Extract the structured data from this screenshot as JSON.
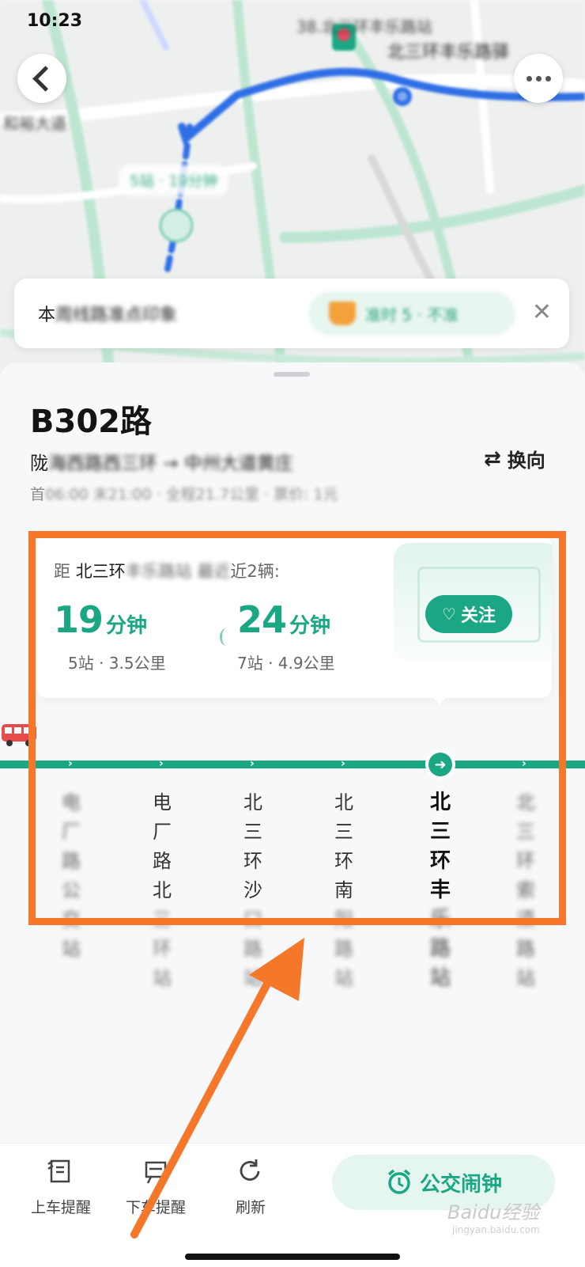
{
  "status_bar": {
    "time": "10:23"
  },
  "notice": {
    "text_visible": "本",
    "text_blurred": "周线路准点印象",
    "badge": "准时 5 · 不准",
    "close": "✕"
  },
  "route": {
    "title": "B302路",
    "direction_visible": "陇",
    "direction_blurred": "海西路西三环 → 中州大道黄庄",
    "info_visible": "首",
    "info_blurred": "06:00 末21:00 · 全程21.7公里 · 票价: 1元",
    "reverse_label": "换向"
  },
  "arrival": {
    "prefix": "距",
    "stop": "北三环",
    "blurred_mid": "丰乐路站 最近",
    "suffix": "近2辆:",
    "buses": [
      {
        "minutes": "19",
        "unit": "分钟",
        "detail": "5站 · 3.5公里"
      },
      {
        "minutes": "24",
        "unit": "分钟",
        "detail": "7站 · 4.9公里"
      }
    ],
    "follow_label": "关注"
  },
  "stops": [
    {
      "visible": "",
      "blurred": "电厂路公交站"
    },
    {
      "visible": "电厂路北",
      "blurred": "三环站"
    },
    {
      "visible": "北三环沙",
      "blurred": "口路站"
    },
    {
      "visible": "北三环南",
      "blurred": "阳路站"
    },
    {
      "visible": "北三环丰",
      "blurred": "乐路站"
    },
    {
      "visible": "",
      "blurred": "北三环索须路站"
    }
  ],
  "toolbar": {
    "board_alert": "上车提醒",
    "alight_alert": "下车提醒",
    "refresh": "刷新",
    "bus_alarm": "公交闹钟"
  },
  "icons": {
    "back": "chevron-left-icon",
    "more": "more-dots-icon",
    "close": "close-icon",
    "swap": "swap-icon",
    "heart": "heart-icon",
    "bus": "bus-icon",
    "arrow": "arrow-right-icon",
    "alarm": "alarm-clock-icon",
    "refresh": "refresh-icon"
  },
  "colors": {
    "accent": "#1ba784",
    "annotation": "#f5782a",
    "route_blue": "#2f6fe6"
  },
  "watermark": {
    "brand": "Baidu经验",
    "site": "jingyan.baidu.com"
  }
}
